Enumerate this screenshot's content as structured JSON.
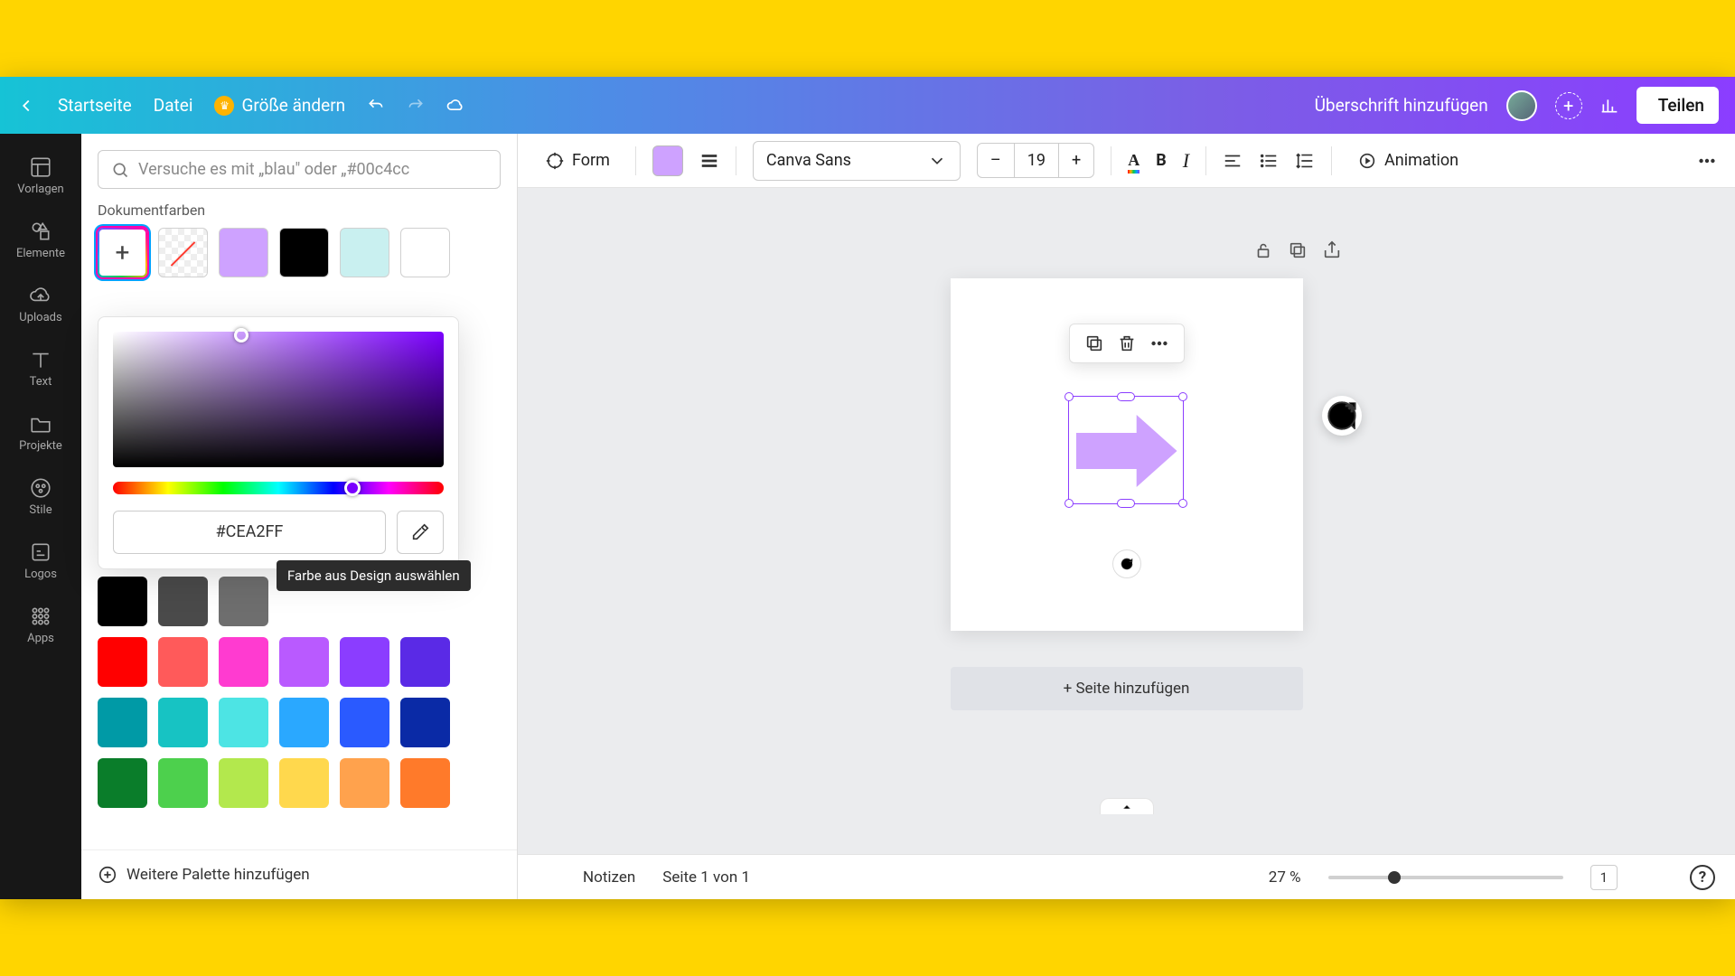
{
  "header": {
    "home": "Startseite",
    "file": "Datei",
    "resize": "Größe ändern",
    "title": "Überschrift hinzufügen",
    "share": "Teilen"
  },
  "navrail": {
    "templates": "Vorlagen",
    "elements": "Elemente",
    "uploads": "Uploads",
    "text": "Text",
    "projects": "Projekte",
    "styles": "Stile",
    "logos": "Logos",
    "apps": "Apps"
  },
  "sidepanel": {
    "search_placeholder": "Versuche es mit „blau\" oder „#00c4cc",
    "doc_colors_label": "Dokumentfarben",
    "more_palette": "Weitere Palette hinzufügen",
    "doc_swatches": [
      "#cea2ff",
      "#000000",
      "#c9f0f0",
      "#ffffff"
    ]
  },
  "picker": {
    "hex": "#CEA2FF",
    "eyedropper_tooltip": "Farbe aus Design auswählen"
  },
  "default_colors_row1": [
    "#000000",
    "#4a4a4a",
    "#6e6e6e"
  ],
  "default_colors": [
    "#ff0000",
    "#ff5a5a",
    "#ff3bd0",
    "#b95aff",
    "#8b3dff",
    "#5a2ae6",
    "#009aa6",
    "#17c3c3",
    "#4de4e4",
    "#2aa8ff",
    "#2a5aff",
    "#0a2aa6",
    "#0a7d2a",
    "#4dd04d",
    "#b3e84d",
    "#ffd84d",
    "#ffa24d",
    "#ff7a2a"
  ],
  "toolbar": {
    "form": "Form",
    "font": "Canva Sans",
    "size": "19",
    "animation": "Animation"
  },
  "canvas": {
    "add_page": "+ Seite hinzufügen"
  },
  "bottombar": {
    "notes": "Notizen",
    "page_of": "Seite 1 von 1",
    "zoom": "27 %",
    "page_badge": "1"
  }
}
